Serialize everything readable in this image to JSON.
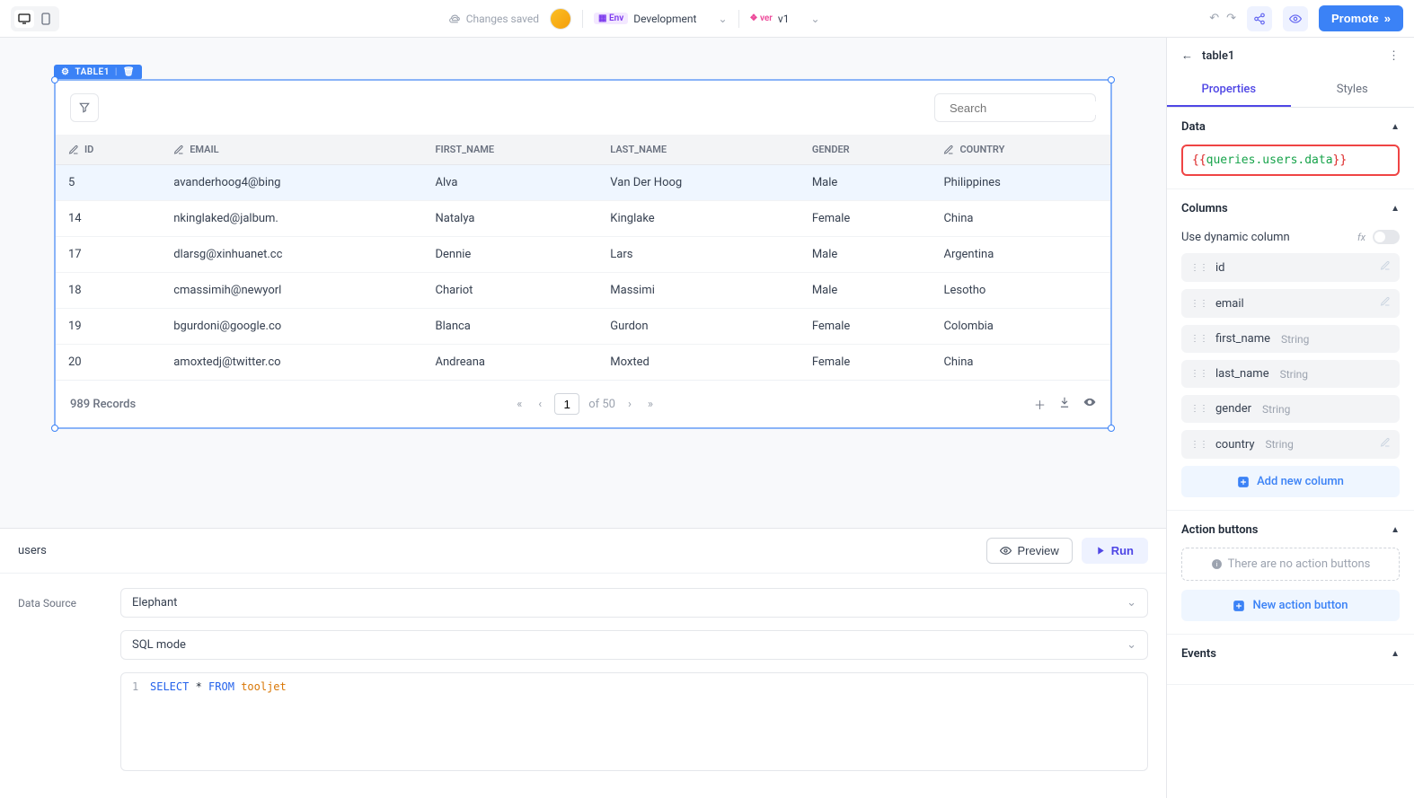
{
  "topbar": {
    "saved_text": "Changes saved",
    "env_label": "Env",
    "env_value": "Development",
    "ver_label": "ver",
    "ver_value": "v1",
    "promote": "Promote"
  },
  "widget": {
    "tag": "TABLE1",
    "search_placeholder": "Search",
    "columns": [
      "ID",
      "EMAIL",
      "FIRST_NAME",
      "LAST_NAME",
      "GENDER",
      "COUNTRY"
    ],
    "rows": [
      {
        "id": "5",
        "email": "avanderhoog4@bing",
        "first_name": "Alva",
        "last_name": "Van Der Hoog",
        "gender": "Male",
        "country": "Philippines"
      },
      {
        "id": "14",
        "email": "nkinglaked@jalbum.",
        "first_name": "Natalya",
        "last_name": "Kinglake",
        "gender": "Female",
        "country": "China"
      },
      {
        "id": "17",
        "email": "dlarsg@xinhuanet.cc",
        "first_name": "Dennie",
        "last_name": "Lars",
        "gender": "Male",
        "country": "Argentina"
      },
      {
        "id": "18",
        "email": "cmassimih@newyorl",
        "first_name": "Chariot",
        "last_name": "Massimi",
        "gender": "Male",
        "country": "Lesotho"
      },
      {
        "id": "19",
        "email": "bgurdoni@google.co",
        "first_name": "Blanca",
        "last_name": "Gurdon",
        "gender": "Female",
        "country": "Colombia"
      },
      {
        "id": "20",
        "email": "amoxtedj@twitter.co",
        "first_name": "Andreana",
        "last_name": "Moxted",
        "gender": "Female",
        "country": "China"
      }
    ],
    "records": "989 Records",
    "page": "1",
    "of_pages": "of 50"
  },
  "query": {
    "name": "users",
    "preview": "Preview",
    "run": "Run",
    "datasource_label": "Data Source",
    "datasource_value": "Elephant",
    "mode_value": "SQL mode",
    "sql_plain": "SELECT * FROM tooljet"
  },
  "panel": {
    "title": "table1",
    "tabs": {
      "properties": "Properties",
      "styles": "Styles"
    },
    "data": {
      "title": "Data",
      "value": "queries.users.data"
    },
    "columns": {
      "title": "Columns",
      "dynamic_label": "Use dynamic column",
      "items": [
        {
          "name": "id",
          "type": ""
        },
        {
          "name": "email",
          "type": ""
        },
        {
          "name": "first_name",
          "type": "String"
        },
        {
          "name": "last_name",
          "type": "String"
        },
        {
          "name": "gender",
          "type": "String"
        },
        {
          "name": "country",
          "type": "String"
        }
      ],
      "add": "Add new column"
    },
    "action_buttons": {
      "title": "Action buttons",
      "empty": "There are no action buttons",
      "new": "New action button"
    },
    "events": {
      "title": "Events"
    }
  }
}
